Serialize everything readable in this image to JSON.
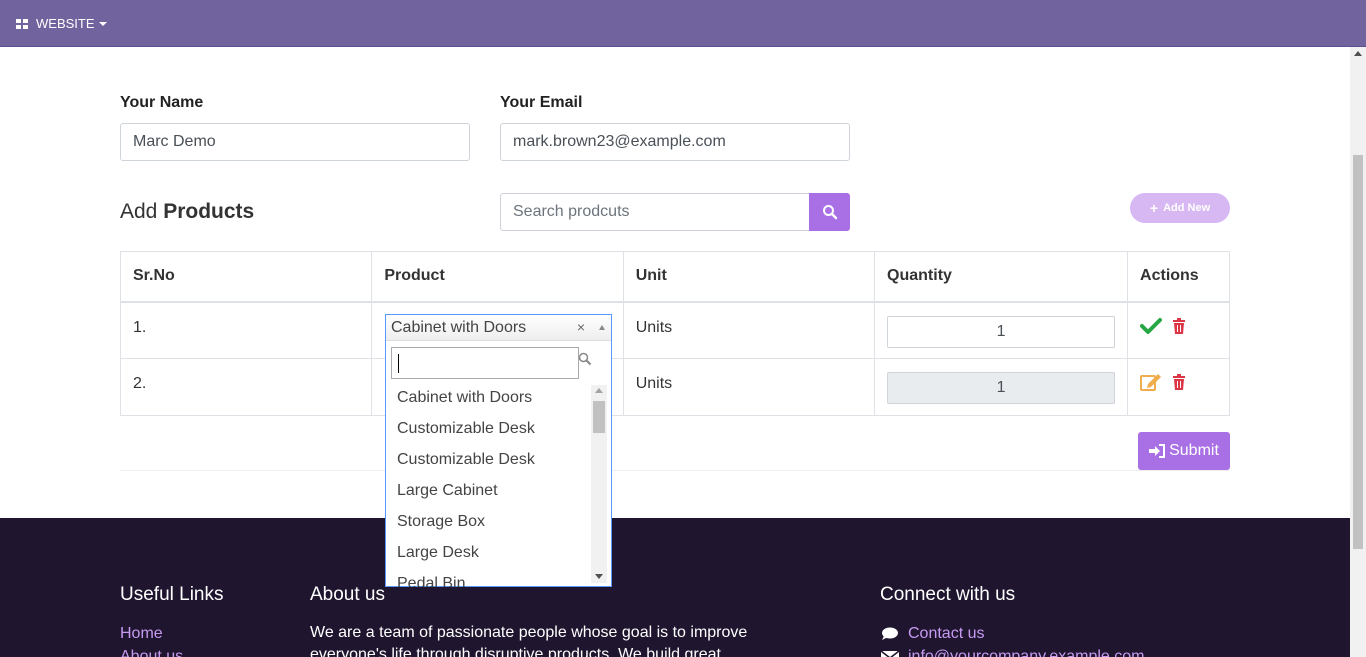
{
  "nav": {
    "menu_label": "WEBSITE"
  },
  "form": {
    "name_label": "Your Name",
    "name_value": "Marc Demo",
    "email_label": "Your Email",
    "email_value": "mark.brown23@example.com"
  },
  "products_heading": {
    "prefix": "Add",
    "bold": "Products"
  },
  "search": {
    "placeholder": "Search prodcuts"
  },
  "add_new_label": "Add New",
  "table": {
    "headers": [
      "Sr.No",
      "Product",
      "Unit",
      "Quantity",
      "Actions"
    ],
    "rows": [
      {
        "sr": "1.",
        "product": "Cabinet with Doors",
        "unit": "Units",
        "quantity": "1"
      },
      {
        "sr": "2.",
        "product": "",
        "unit": "Units",
        "quantity": "1"
      }
    ]
  },
  "dropdown": {
    "selected": "Cabinet with Doors",
    "clear_glyph": "×",
    "options": [
      "Cabinet with Doors",
      "Customizable Desk",
      "Customizable Desk",
      "Large Cabinet",
      "Storage Box",
      "Large Desk",
      "Pedal Bin"
    ]
  },
  "submit_label": "Submit",
  "footer": {
    "useful_links_title": "Useful Links",
    "links": [
      "Home",
      "About us"
    ],
    "about_title": "About us",
    "about_text_1": "We are a team of passionate people whose goal is to improve",
    "about_text_2": "everyone's life through disruptive products. We build great",
    "connect_title": "Connect with us",
    "contact_label": "Contact us",
    "email_label": "info@yourcompany.example.com"
  },
  "colors": {
    "navbar": "#71639e",
    "accent": "#a970e6",
    "footer_bg": "#1f152f",
    "link": "#c79af2",
    "success": "#28a745",
    "danger": "#dc3545",
    "warning": "#f0ad4e"
  }
}
